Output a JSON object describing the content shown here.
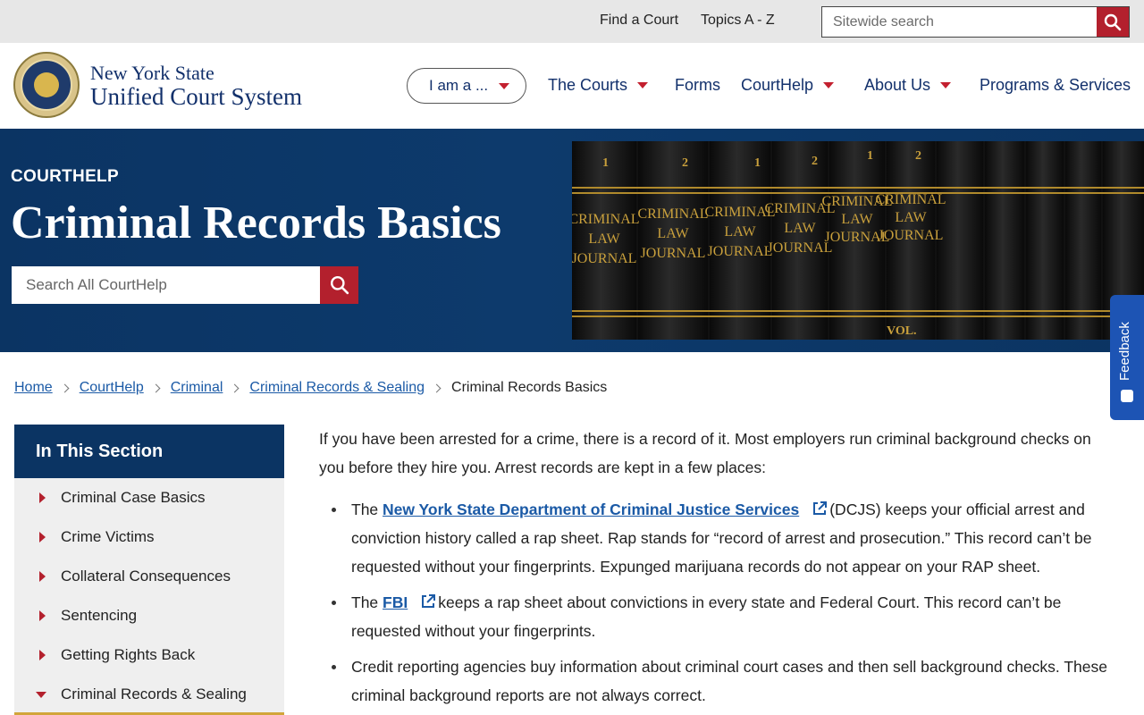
{
  "utility": {
    "find_court": "Find a Court",
    "topics": "Topics A - Z",
    "search_placeholder": "Sitewide search"
  },
  "header": {
    "brand_line1": "New York State",
    "brand_line2": "Unified Court System",
    "iam": "I am a ...",
    "nav": [
      "The Courts",
      "Forms",
      "CourtHelp",
      "About Us",
      "Programs & Services"
    ]
  },
  "hero": {
    "kicker": "COURTHELP",
    "title": "Criminal Records Basics",
    "search_placeholder": "Search All CourtHelp",
    "book_labels": [
      "CRIMINAL",
      "LAW",
      "JOURNAL",
      "VOL."
    ]
  },
  "feedback": "Feedback",
  "breadcrumb": {
    "items": [
      "Home",
      "CourtHelp",
      "Criminal",
      "Criminal Records & Sealing"
    ],
    "current": "Criminal Records Basics"
  },
  "sidebar": {
    "title": "In This Section",
    "items": [
      "Criminal Case Basics",
      "Crime Victims",
      "Collateral Consequences",
      "Sentencing",
      "Getting Rights Back",
      "Criminal Records & Sealing"
    ]
  },
  "content": {
    "intro": "If you have been arrested for a crime, there is a record of it. Most employers run criminal background checks on you before they hire you. Arrest records are kept in a few places:",
    "b1_pre": "The",
    "b1_link": "New York State Department of Criminal Justice Services",
    "b1_post": "(DCJS) keeps your official arrest and conviction history called a rap sheet. Rap stands for “record of arrest and prosecution.” This record can’t be requested without your fingerprints. Expunged marijuana records do not appear on your RAP sheet.",
    "b2_pre": "The",
    "b2_link": "FBI",
    "b2_post": "keeps a rap sheet about convictions in every state and Federal Court. This record can’t be requested without your fingerprints.",
    "b3": "Credit reporting agencies buy information about criminal court cases and then sell background checks. These criminal background reports are not always correct."
  },
  "colors": {
    "navy": "#0b3463",
    "red": "#b3202d",
    "link": "#1b5aa6",
    "gold": "#d2a53a"
  }
}
